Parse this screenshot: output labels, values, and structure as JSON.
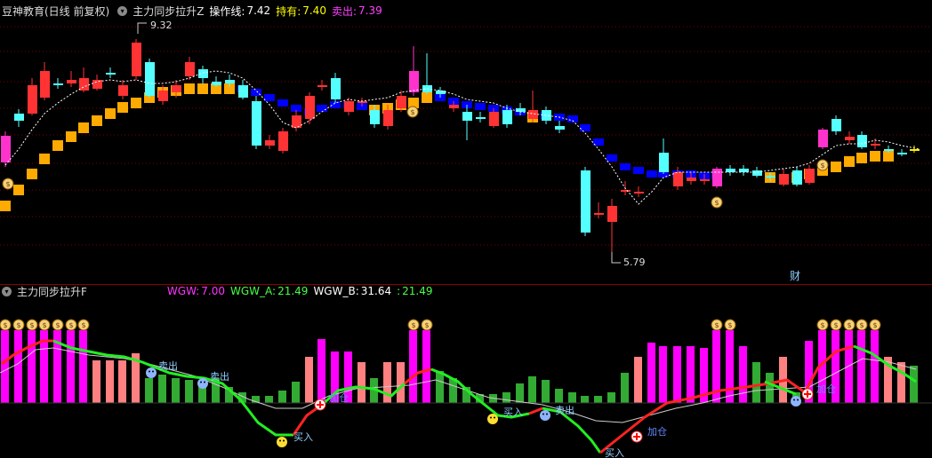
{
  "header": {
    "stock_title": "豆神教育(日线 前复权)",
    "indicator_name": "主力同步拉升Z",
    "items": [
      {
        "label": "操作线:",
        "value": "7.42",
        "color": "#ffffff"
      },
      {
        "label": "持有:",
        "value": "7.40",
        "color": "#ffff00"
      },
      {
        "label": "卖出:",
        "value": "7.39",
        "color": "#ff40ff"
      }
    ]
  },
  "price_panel": {
    "high_label": "9.32",
    "low_label": "5.79",
    "cai_label": "财",
    "colors": {
      "up": "#ff3333",
      "down": "#54ffff",
      "pink": "#ff33cc",
      "orange": "#ffaa00",
      "blue": "#0000ff",
      "yellow": "#ffee00"
    }
  },
  "sub_panel": {
    "name": "主力同步拉升F",
    "items": [
      {
        "label": "WGW:",
        "value": "7.00",
        "color": "#ff33ff"
      },
      {
        "label": "WGW_A:",
        "value": "21.49",
        "color": "#44ff44"
      },
      {
        "label": "WGW_B:",
        "value": "31.64",
        "color": "#ffffff"
      },
      {
        "label": ":",
        "value": "21.49",
        "color": "#44ff44"
      }
    ],
    "signals": {
      "buy": "买入",
      "sell": "卖出",
      "add": "加仓"
    }
  }
}
